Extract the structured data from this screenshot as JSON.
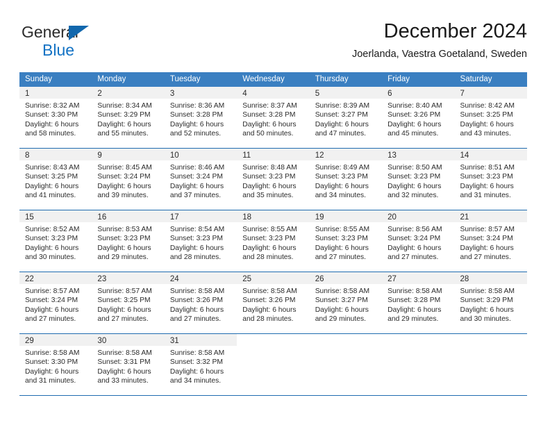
{
  "brand": {
    "line1": "General",
    "line2": "Blue",
    "triangle_icon": "triangle-icon",
    "colors": {
      "dark": "#2b2b2b",
      "blue": "#1272c4",
      "triangle": "#1167ad"
    }
  },
  "header": {
    "title": "December 2024",
    "subtitle": "Joerlanda, Vaestra Goetaland, Sweden"
  },
  "theme": {
    "header_bg": "#3a7fc1",
    "header_text": "#ffffff",
    "daynum_band_bg": "#f1f1f1",
    "week_rule": "#1f6cb0",
    "body_text": "#2b2b2b"
  },
  "weekday_headers": [
    "Sunday",
    "Monday",
    "Tuesday",
    "Wednesday",
    "Thursday",
    "Friday",
    "Saturday"
  ],
  "weeks": [
    [
      {
        "day": "1",
        "sunrise": "Sunrise: 8:32 AM",
        "sunset": "Sunset: 3:30 PM",
        "daylight_line1": "Daylight: 6 hours",
        "daylight_line2": "and 58 minutes."
      },
      {
        "day": "2",
        "sunrise": "Sunrise: 8:34 AM",
        "sunset": "Sunset: 3:29 PM",
        "daylight_line1": "Daylight: 6 hours",
        "daylight_line2": "and 55 minutes."
      },
      {
        "day": "3",
        "sunrise": "Sunrise: 8:36 AM",
        "sunset": "Sunset: 3:28 PM",
        "daylight_line1": "Daylight: 6 hours",
        "daylight_line2": "and 52 minutes."
      },
      {
        "day": "4",
        "sunrise": "Sunrise: 8:37 AM",
        "sunset": "Sunset: 3:28 PM",
        "daylight_line1": "Daylight: 6 hours",
        "daylight_line2": "and 50 minutes."
      },
      {
        "day": "5",
        "sunrise": "Sunrise: 8:39 AM",
        "sunset": "Sunset: 3:27 PM",
        "daylight_line1": "Daylight: 6 hours",
        "daylight_line2": "and 47 minutes."
      },
      {
        "day": "6",
        "sunrise": "Sunrise: 8:40 AM",
        "sunset": "Sunset: 3:26 PM",
        "daylight_line1": "Daylight: 6 hours",
        "daylight_line2": "and 45 minutes."
      },
      {
        "day": "7",
        "sunrise": "Sunrise: 8:42 AM",
        "sunset": "Sunset: 3:25 PM",
        "daylight_line1": "Daylight: 6 hours",
        "daylight_line2": "and 43 minutes."
      }
    ],
    [
      {
        "day": "8",
        "sunrise": "Sunrise: 8:43 AM",
        "sunset": "Sunset: 3:25 PM",
        "daylight_line1": "Daylight: 6 hours",
        "daylight_line2": "and 41 minutes."
      },
      {
        "day": "9",
        "sunrise": "Sunrise: 8:45 AM",
        "sunset": "Sunset: 3:24 PM",
        "daylight_line1": "Daylight: 6 hours",
        "daylight_line2": "and 39 minutes."
      },
      {
        "day": "10",
        "sunrise": "Sunrise: 8:46 AM",
        "sunset": "Sunset: 3:24 PM",
        "daylight_line1": "Daylight: 6 hours",
        "daylight_line2": "and 37 minutes."
      },
      {
        "day": "11",
        "sunrise": "Sunrise: 8:48 AM",
        "sunset": "Sunset: 3:23 PM",
        "daylight_line1": "Daylight: 6 hours",
        "daylight_line2": "and 35 minutes."
      },
      {
        "day": "12",
        "sunrise": "Sunrise: 8:49 AM",
        "sunset": "Sunset: 3:23 PM",
        "daylight_line1": "Daylight: 6 hours",
        "daylight_line2": "and 34 minutes."
      },
      {
        "day": "13",
        "sunrise": "Sunrise: 8:50 AM",
        "sunset": "Sunset: 3:23 PM",
        "daylight_line1": "Daylight: 6 hours",
        "daylight_line2": "and 32 minutes."
      },
      {
        "day": "14",
        "sunrise": "Sunrise: 8:51 AM",
        "sunset": "Sunset: 3:23 PM",
        "daylight_line1": "Daylight: 6 hours",
        "daylight_line2": "and 31 minutes."
      }
    ],
    [
      {
        "day": "15",
        "sunrise": "Sunrise: 8:52 AM",
        "sunset": "Sunset: 3:23 PM",
        "daylight_line1": "Daylight: 6 hours",
        "daylight_line2": "and 30 minutes."
      },
      {
        "day": "16",
        "sunrise": "Sunrise: 8:53 AM",
        "sunset": "Sunset: 3:23 PM",
        "daylight_line1": "Daylight: 6 hours",
        "daylight_line2": "and 29 minutes."
      },
      {
        "day": "17",
        "sunrise": "Sunrise: 8:54 AM",
        "sunset": "Sunset: 3:23 PM",
        "daylight_line1": "Daylight: 6 hours",
        "daylight_line2": "and 28 minutes."
      },
      {
        "day": "18",
        "sunrise": "Sunrise: 8:55 AM",
        "sunset": "Sunset: 3:23 PM",
        "daylight_line1": "Daylight: 6 hours",
        "daylight_line2": "and 28 minutes."
      },
      {
        "day": "19",
        "sunrise": "Sunrise: 8:55 AM",
        "sunset": "Sunset: 3:23 PM",
        "daylight_line1": "Daylight: 6 hours",
        "daylight_line2": "and 27 minutes."
      },
      {
        "day": "20",
        "sunrise": "Sunrise: 8:56 AM",
        "sunset": "Sunset: 3:24 PM",
        "daylight_line1": "Daylight: 6 hours",
        "daylight_line2": "and 27 minutes."
      },
      {
        "day": "21",
        "sunrise": "Sunrise: 8:57 AM",
        "sunset": "Sunset: 3:24 PM",
        "daylight_line1": "Daylight: 6 hours",
        "daylight_line2": "and 27 minutes."
      }
    ],
    [
      {
        "day": "22",
        "sunrise": "Sunrise: 8:57 AM",
        "sunset": "Sunset: 3:24 PM",
        "daylight_line1": "Daylight: 6 hours",
        "daylight_line2": "and 27 minutes."
      },
      {
        "day": "23",
        "sunrise": "Sunrise: 8:57 AM",
        "sunset": "Sunset: 3:25 PM",
        "daylight_line1": "Daylight: 6 hours",
        "daylight_line2": "and 27 minutes."
      },
      {
        "day": "24",
        "sunrise": "Sunrise: 8:58 AM",
        "sunset": "Sunset: 3:26 PM",
        "daylight_line1": "Daylight: 6 hours",
        "daylight_line2": "and 27 minutes."
      },
      {
        "day": "25",
        "sunrise": "Sunrise: 8:58 AM",
        "sunset": "Sunset: 3:26 PM",
        "daylight_line1": "Daylight: 6 hours",
        "daylight_line2": "and 28 minutes."
      },
      {
        "day": "26",
        "sunrise": "Sunrise: 8:58 AM",
        "sunset": "Sunset: 3:27 PM",
        "daylight_line1": "Daylight: 6 hours",
        "daylight_line2": "and 29 minutes."
      },
      {
        "day": "27",
        "sunrise": "Sunrise: 8:58 AM",
        "sunset": "Sunset: 3:28 PM",
        "daylight_line1": "Daylight: 6 hours",
        "daylight_line2": "and 29 minutes."
      },
      {
        "day": "28",
        "sunrise": "Sunrise: 8:58 AM",
        "sunset": "Sunset: 3:29 PM",
        "daylight_line1": "Daylight: 6 hours",
        "daylight_line2": "and 30 minutes."
      }
    ],
    [
      {
        "day": "29",
        "sunrise": "Sunrise: 8:58 AM",
        "sunset": "Sunset: 3:30 PM",
        "daylight_line1": "Daylight: 6 hours",
        "daylight_line2": "and 31 minutes."
      },
      {
        "day": "30",
        "sunrise": "Sunrise: 8:58 AM",
        "sunset": "Sunset: 3:31 PM",
        "daylight_line1": "Daylight: 6 hours",
        "daylight_line2": "and 33 minutes."
      },
      {
        "day": "31",
        "sunrise": "Sunrise: 8:58 AM",
        "sunset": "Sunset: 3:32 PM",
        "daylight_line1": "Daylight: 6 hours",
        "daylight_line2": "and 34 minutes."
      },
      {
        "day": "",
        "sunrise": "",
        "sunset": "",
        "daylight_line1": "",
        "daylight_line2": ""
      },
      {
        "day": "",
        "sunrise": "",
        "sunset": "",
        "daylight_line1": "",
        "daylight_line2": ""
      },
      {
        "day": "",
        "sunrise": "",
        "sunset": "",
        "daylight_line1": "",
        "daylight_line2": ""
      },
      {
        "day": "",
        "sunrise": "",
        "sunset": "",
        "daylight_line1": "",
        "daylight_line2": ""
      }
    ]
  ]
}
